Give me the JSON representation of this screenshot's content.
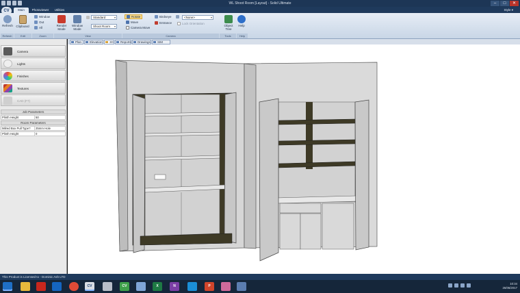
{
  "window": {
    "title": "WL Shoot Room [Layout] - Solid Ultimate",
    "controls": [
      "–",
      "□",
      "✕"
    ]
  },
  "app": {
    "logo": "CV"
  },
  "ribbon": {
    "tabs": [
      {
        "label": "Main",
        "active": true
      },
      {
        "label": "Photoviewer",
        "active": false
      },
      {
        "label": "Utilities",
        "active": false
      }
    ],
    "style_menu": "Style ▾",
    "buttons": {
      "refresh": "Refresh",
      "clipboard": "Clipboard",
      "window": "Window",
      "out": "Out",
      "all": "All",
      "render_mode": "Render Mode",
      "window_mode": "Window Mode",
      "rotate": "Rotate",
      "move": "Move",
      "camera_move": "Camera Move",
      "birdseye": "Birdseye",
      "entrance": "Entrance",
      "lock_orientation": "Lock Orientation",
      "object_tree": "Object Tree",
      "help": "Help"
    },
    "combos": {
      "render_style": "Standard",
      "room": "Shoot Room",
      "camera_preset": "<None>"
    },
    "groups": [
      "Refresh",
      "Edit",
      "Zoom",
      "View",
      "Camera",
      "Tools",
      "Help"
    ]
  },
  "sidebar": {
    "items": [
      {
        "label": "Camera",
        "icon": "camera-icon",
        "enabled": true
      },
      {
        "label": "Lights",
        "icon": "lights-icon",
        "enabled": true
      },
      {
        "label": "Finishes",
        "icon": "finishes-icon",
        "enabled": true
      },
      {
        "label": "Textures",
        "icon": "textures-icon",
        "enabled": true
      },
      {
        "label": "CAD (F7)",
        "icon": "cad-icon",
        "enabled": false
      }
    ],
    "job_parameters": {
      "title": "Job Parameters",
      "rows": [
        {
          "key": "Plinth Height",
          "value": "50"
        }
      ]
    },
    "room_parameters": {
      "title": "Room Parameters",
      "rows": [
        {
          "key": "Milred Box Pull Type?",
          "value": "25mm Hole"
        },
        {
          "key": "Plinth Height",
          "value": "0"
        }
      ]
    }
  },
  "doc_tabs": [
    {
      "label": "Plan",
      "active": false
    },
    {
      "label": "Elevation",
      "active": false
    },
    {
      "label": "3D",
      "active": true
    },
    {
      "label": "Reports",
      "active": false
    },
    {
      "label": "Drawings",
      "active": false
    },
    {
      "label": "SIM Center",
      "active": false
    }
  ],
  "status": {
    "license": "This Product is Licensed to - Dominic Ash LTD"
  },
  "taskbar": {
    "apps": [
      {
        "name": "start-button",
        "label": "",
        "color": "#1f6fc5"
      },
      {
        "name": "file-explorer-icon",
        "label": "",
        "color": "#e7b93c"
      },
      {
        "name": "acrobat-icon",
        "label": "",
        "color": "#c8271d"
      },
      {
        "name": "outlook-icon",
        "label": "",
        "color": "#1565c0"
      },
      {
        "name": "chrome-icon",
        "label": "",
        "color": "#e04b36"
      },
      {
        "name": "cv-app-icon",
        "label": "CV",
        "color": "#d9dde3"
      },
      {
        "name": "tool-icon",
        "label": "",
        "color": "#b8bec8"
      },
      {
        "name": "cv-green-icon",
        "label": "CV",
        "color": "#3ea04a"
      },
      {
        "name": "network-icon",
        "label": "",
        "color": "#7fa5d6"
      },
      {
        "name": "excel-icon",
        "label": "X",
        "color": "#1e7a44"
      },
      {
        "name": "onenote-icon",
        "label": "N",
        "color": "#7b3fa6"
      },
      {
        "name": "skype-icon",
        "label": "",
        "color": "#1b8fd6"
      },
      {
        "name": "powerpoint-icon",
        "label": "P",
        "color": "#d0452b"
      },
      {
        "name": "paint-icon",
        "label": "",
        "color": "#d06a9a"
      },
      {
        "name": "remote-icon",
        "label": "",
        "color": "#5b7db0"
      }
    ],
    "tray": {
      "time": "10:34",
      "date": "26/06/2017"
    }
  },
  "colors": {
    "carcass": "#d3d3d3",
    "interior_dark": "#3e3a26",
    "ribbon_light": "#e6edf6",
    "chrome_dark": "#1f3a5c"
  }
}
